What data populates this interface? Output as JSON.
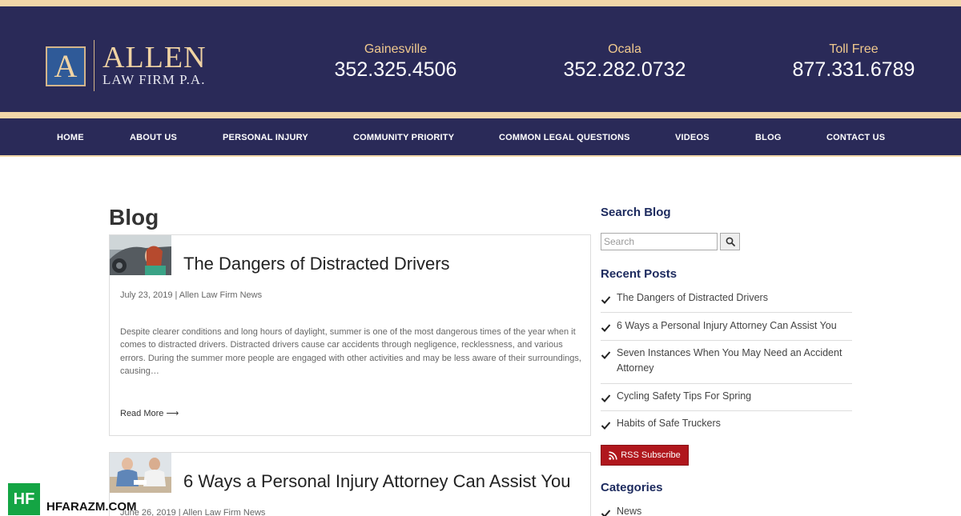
{
  "brand": {
    "logo_letter": "A",
    "name": "ALLEN",
    "sub": "LAW FIRM P.A.",
    "colors": {
      "navy": "#2a2a58",
      "gold": "#f1d6a8",
      "accent_red": "#b0171d"
    }
  },
  "phones": [
    {
      "label": "Gainesville",
      "number": "352.325.4506"
    },
    {
      "label": "Ocala",
      "number": "352.282.0732"
    },
    {
      "label": "Toll Free",
      "number": "877.331.6789"
    }
  ],
  "nav": {
    "items": [
      {
        "label": "HOME"
      },
      {
        "label": "ABOUT US"
      },
      {
        "label": "PERSONAL INJURY"
      },
      {
        "label": "COMMUNITY PRIORITY"
      },
      {
        "label": "COMMON LEGAL QUESTIONS"
      },
      {
        "label": "VIDEOS"
      },
      {
        "label": "BLOG"
      },
      {
        "label": "CONTACT US"
      }
    ]
  },
  "main": {
    "title": "Blog",
    "posts": [
      {
        "title": "The Dangers of Distracted Drivers",
        "meta": "July 23, 2019 | Allen Law Firm News",
        "excerpt": "Despite clearer conditions and long hours of daylight, summer is one of the most dangerous times of the year when it comes to distracted drivers. Distracted drivers cause car accidents through negligence, recklessness, and various errors. During the summer more people are engaged with other activities and may be less aware of their surroundings, causing…",
        "read_more": "Read More ⟶"
      },
      {
        "title": "6 Ways a Personal Injury Attorney Can Assist You",
        "meta": "June 26, 2019 | Allen Law Firm News"
      }
    ]
  },
  "sidebar": {
    "search_heading": "Search Blog",
    "search_placeholder": "Search",
    "search_icon": "search-icon",
    "recent_heading": "Recent Posts",
    "recent_posts": [
      {
        "label": "The Dangers of Distracted Drivers"
      },
      {
        "label": "6 Ways a Personal Injury Attorney Can Assist You"
      },
      {
        "label": "Seven Instances When You May Need an Accident Attorney"
      },
      {
        "label": "Cycling Safety Tips For Spring"
      },
      {
        "label": "Habits of Safe Truckers"
      }
    ],
    "rss_label": "RSS Subscribe",
    "categories_heading": "Categories",
    "categories": [
      {
        "label": "News"
      }
    ]
  },
  "watermark": {
    "badge": "HF",
    "text": "HFARAZM.COM"
  }
}
